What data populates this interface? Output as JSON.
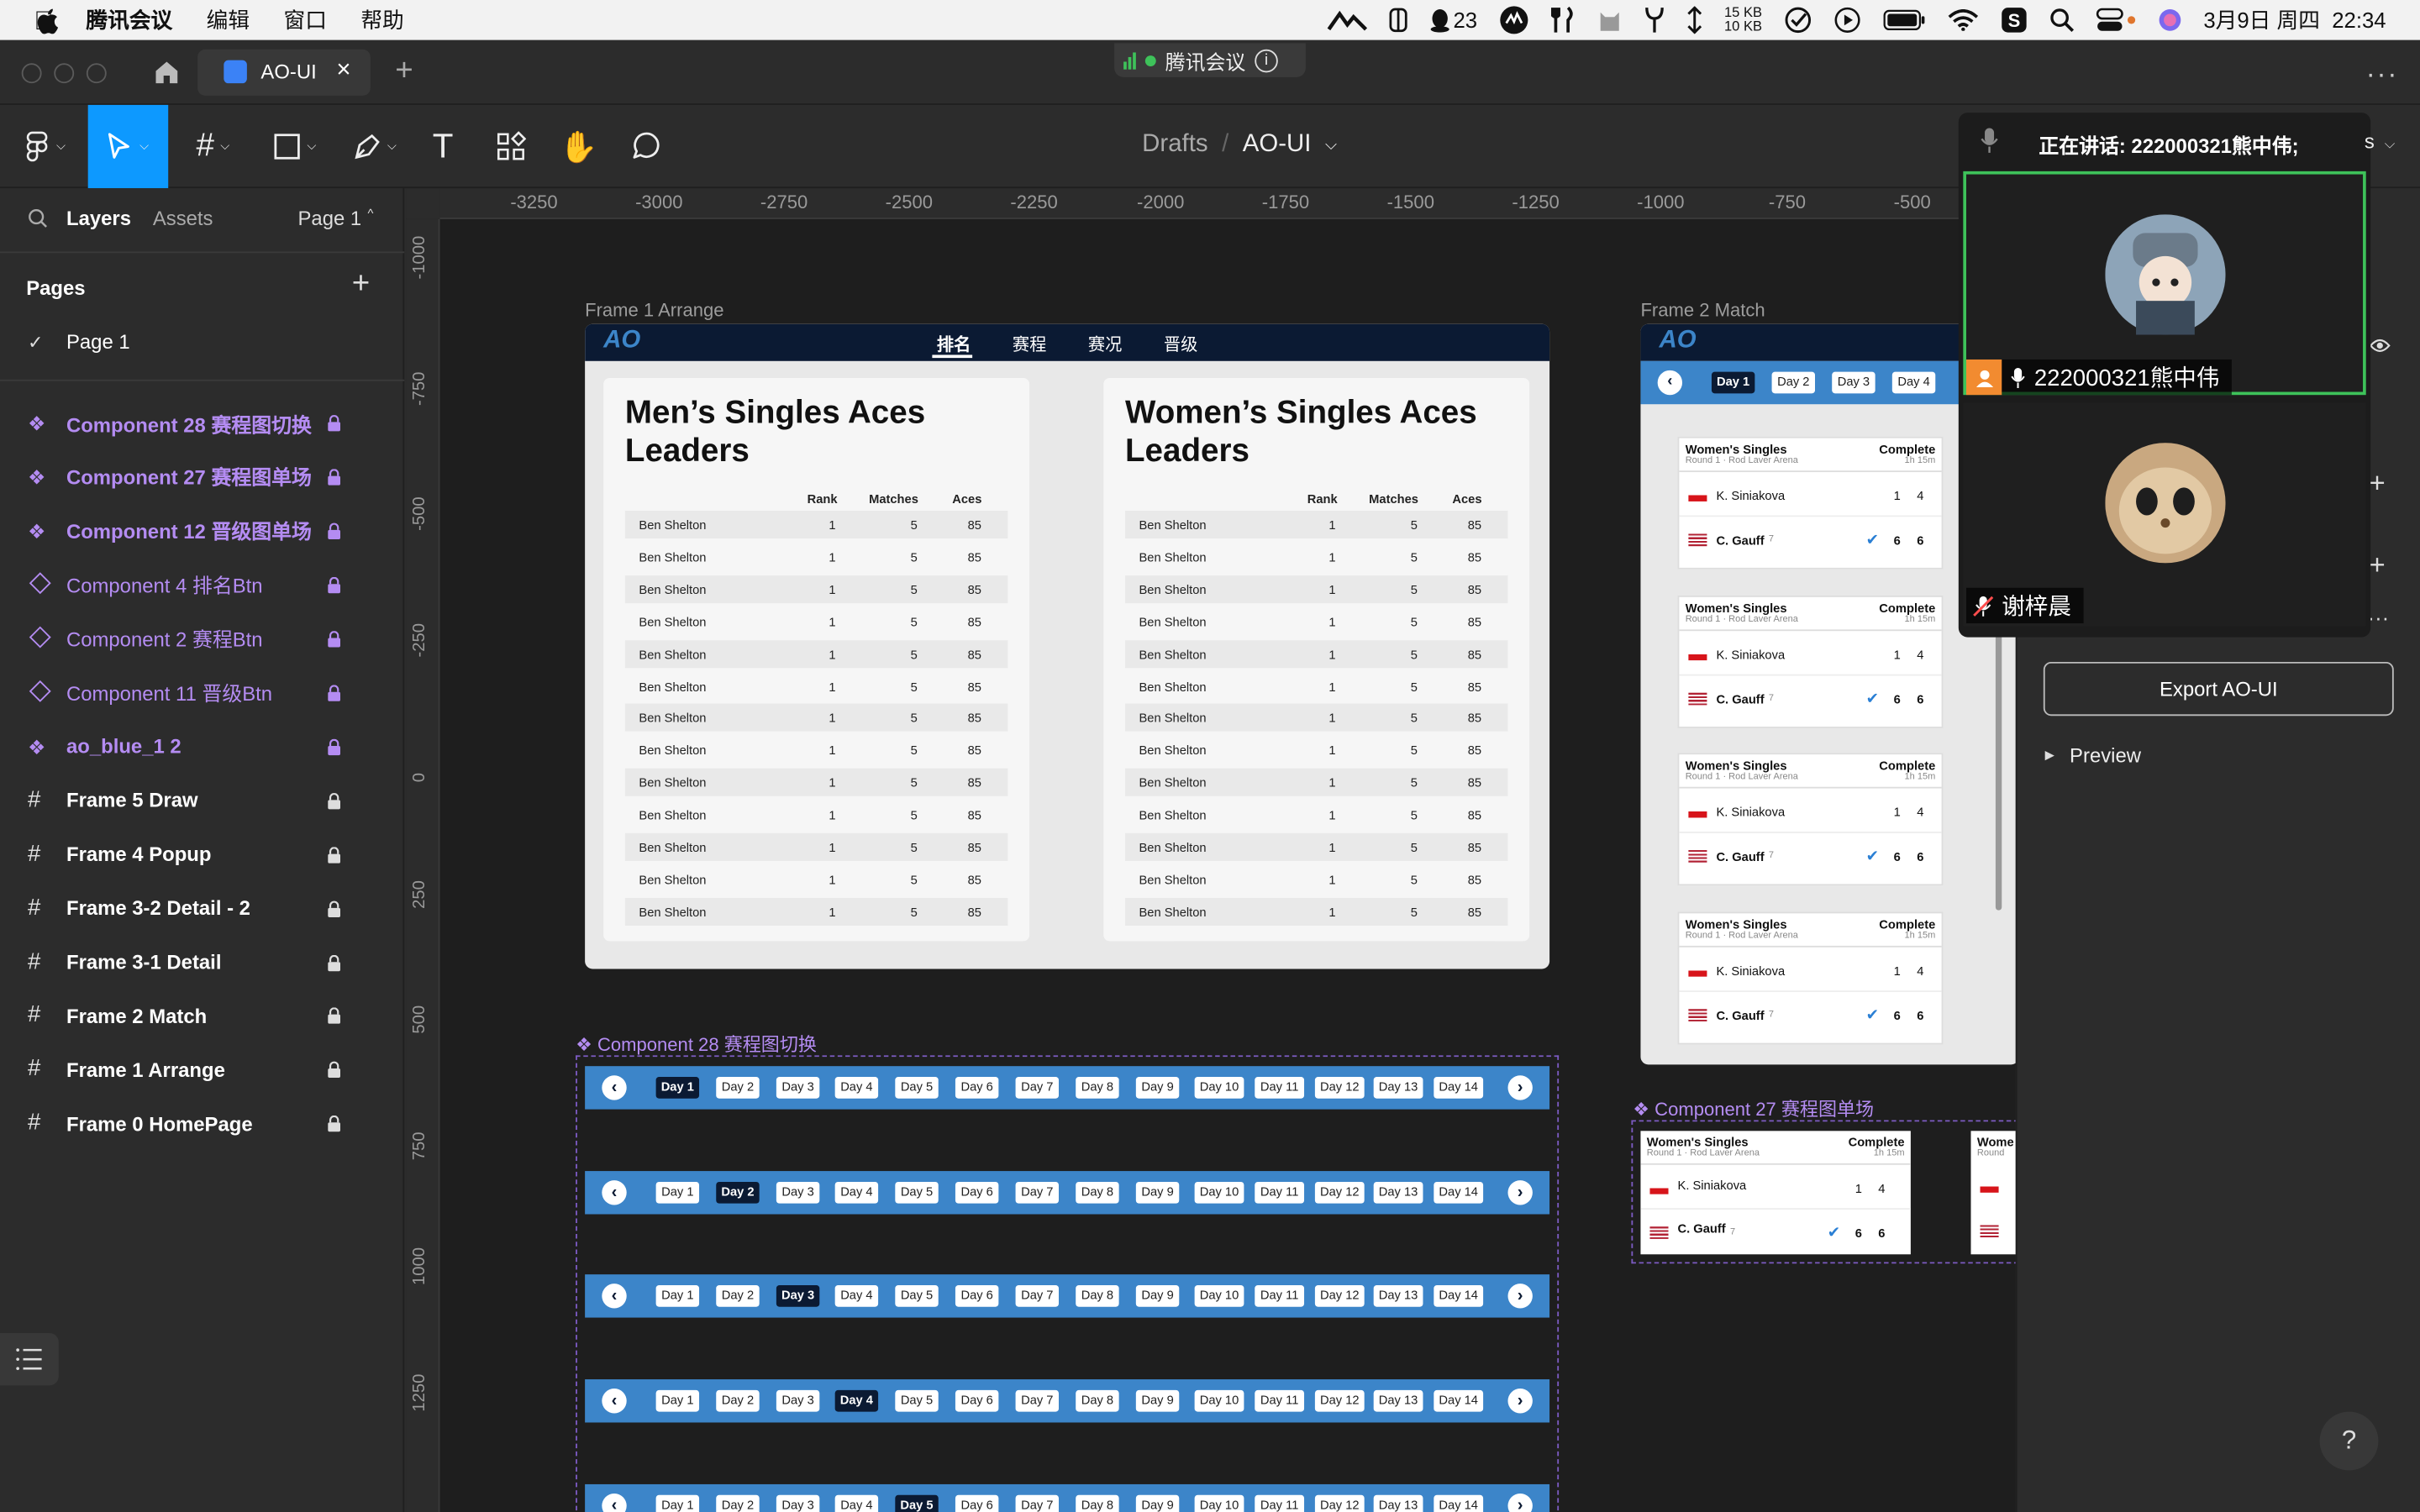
{
  "menubar": {
    "app": "腾讯会议",
    "items": [
      "编辑",
      "窗口",
      "帮助"
    ],
    "qq_count": "23",
    "net_up": "15 KB",
    "net_down": "10 KB",
    "datetime": "3月9日 周四  22:34"
  },
  "window": {
    "tab_title": "AO-UI",
    "meeting_badge": "腾讯会议"
  },
  "toolbar": {
    "breadcrumb_parent": "Drafts",
    "breadcrumb_sep": "/",
    "file_name": "AO-UI"
  },
  "left": {
    "tab_layers": "Layers",
    "tab_assets": "Assets",
    "page_selector": "Page 1",
    "pages_heading": "Pages",
    "current_page": "Page 1",
    "layers": [
      {
        "name": "Component 28 赛程图切换",
        "kind": "component"
      },
      {
        "name": "Component 27 赛程图单场",
        "kind": "component"
      },
      {
        "name": "Component 12 晋级图单场",
        "kind": "component"
      },
      {
        "name": "Component 4 排名Btn",
        "kind": "instance"
      },
      {
        "name": "Component 2 赛程Btn",
        "kind": "instance"
      },
      {
        "name": "Component 11 晋级Btn",
        "kind": "instance"
      },
      {
        "name": "ao_blue_1 2",
        "kind": "component"
      },
      {
        "name": "Frame 5 Draw",
        "kind": "frame"
      },
      {
        "name": "Frame 4 Popup",
        "kind": "frame"
      },
      {
        "name": "Frame 3-2 Detail - 2",
        "kind": "frame"
      },
      {
        "name": "Frame 3-1 Detail",
        "kind": "frame"
      },
      {
        "name": "Frame 2 Match",
        "kind": "frame"
      },
      {
        "name": "Frame 1 Arrange",
        "kind": "frame"
      },
      {
        "name": "Frame 0 HomePage",
        "kind": "frame"
      }
    ]
  },
  "rulers": {
    "top": [
      "-3250",
      "-3000",
      "-2750",
      "-2500",
      "-2250",
      "-2000",
      "-1750",
      "-1500",
      "-1250",
      "-1000",
      "-750",
      "-500"
    ],
    "left": [
      "-1000",
      "-750",
      "-500",
      "-250",
      "0",
      "250",
      "500",
      "750",
      "1000",
      "1250"
    ]
  },
  "frame1": {
    "label": "Frame 1 Arrange",
    "logo": "AO",
    "nav": [
      "排名",
      "赛程",
      "赛况",
      "晋级"
    ],
    "cards": [
      {
        "title": "Men’s Singles Aces Leaders"
      },
      {
        "title": "Women’s Singles Aces Leaders"
      }
    ],
    "columns": [
      "Rank",
      "Matches",
      "Aces"
    ],
    "rows": [
      [
        "Ben Shelton",
        "1",
        "5",
        "85"
      ],
      [
        "Ben Shelton",
        "1",
        "5",
        "85"
      ],
      [
        "Ben Shelton",
        "1",
        "5",
        "85"
      ],
      [
        "Ben Shelton",
        "1",
        "5",
        "85"
      ],
      [
        "Ben Shelton",
        "1",
        "5",
        "85"
      ],
      [
        "Ben Shelton",
        "1",
        "5",
        "85"
      ],
      [
        "Ben Shelton",
        "1",
        "5",
        "85"
      ],
      [
        "Ben Shelton",
        "1",
        "5",
        "85"
      ],
      [
        "Ben Shelton",
        "1",
        "5",
        "85"
      ],
      [
        "Ben Shelton",
        "1",
        "5",
        "85"
      ],
      [
        "Ben Shelton",
        "1",
        "5",
        "85"
      ],
      [
        "Ben Shelton",
        "1",
        "5",
        "85"
      ],
      [
        "Ben Shelton",
        "1",
        "5",
        "85"
      ]
    ]
  },
  "frame2": {
    "label": "Frame 2 Match",
    "logo": "AO",
    "days": [
      "Day 1",
      "Day 2",
      "Day 3",
      "Day 4"
    ]
  },
  "match": {
    "event": "Women's Singles",
    "round": "Round 1 · Rod Laver Arena",
    "status": "Complete",
    "duration": "1h 15m",
    "p1": "K. Siniakova",
    "p1_s1": "1",
    "p1_s2": "4",
    "p2": "C. Gauff",
    "p2_seed": "7",
    "p2_s1": "6",
    "p2_s2": "6",
    "other_event": "Wome",
    "other_round": "Round"
  },
  "component28": {
    "label": "Component 28 赛程图切换",
    "days": [
      "Day 1",
      "Day 2",
      "Day 3",
      "Day 4",
      "Day 5",
      "Day 6",
      "Day 7",
      "Day 8",
      "Day 9",
      "Day 10",
      "Day 11",
      "Day 12",
      "Day 13",
      "Day 14"
    ]
  },
  "component27": {
    "label": "Component 27 赛程图单场"
  },
  "right": {
    "export_label": "Export AO-UI",
    "preview_label": "Preview"
  },
  "meeting": {
    "speaking": "正在讲话: 222000321熊中伟;",
    "speaking_tail": "s",
    "participant1": "222000321熊中伟",
    "participant2": "谢梓晨"
  },
  "colors": {
    "accent": "#0d99ff",
    "nav": "#0b1a33",
    "daybar": "#3c85c9",
    "component": "#b48cf2",
    "meeting_green": "#3ec25a"
  }
}
